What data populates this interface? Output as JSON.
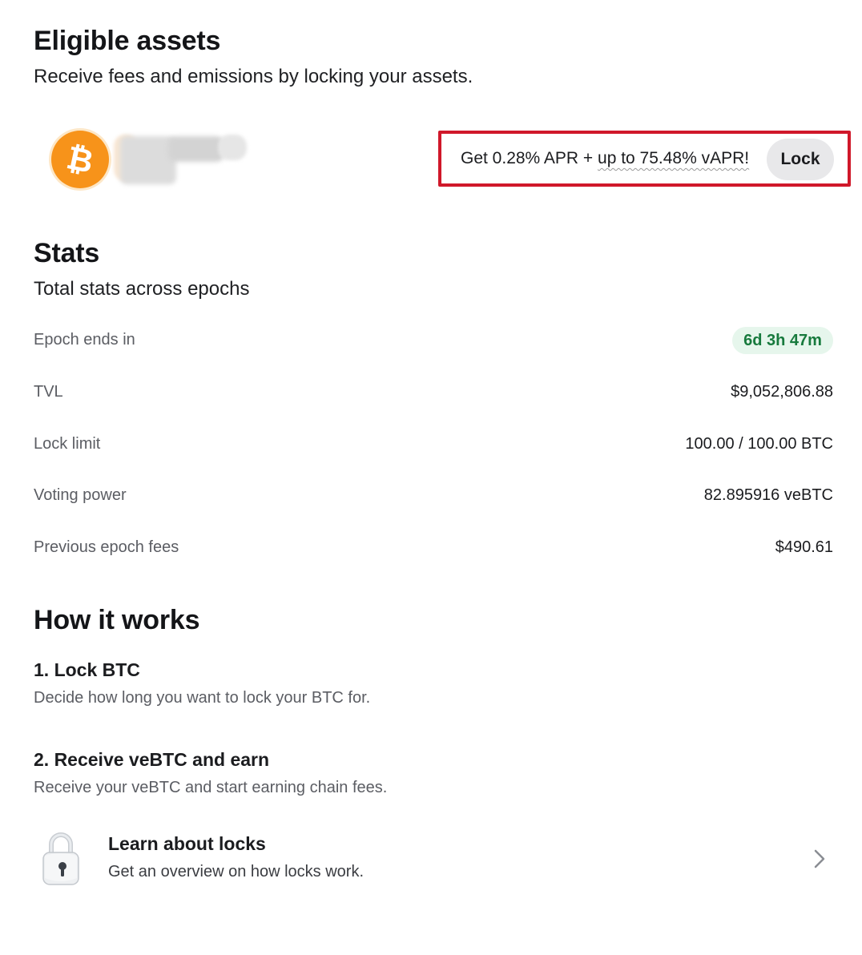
{
  "eligible": {
    "title": "Eligible assets",
    "subtitle": "Receive fees and emissions by locking your assets.",
    "asset_icon": "bitcoin-icon",
    "promo": {
      "prefix": "Get 0.28% APR + ",
      "highlight": "up to 75.48% vAPR!",
      "button_label": "Lock"
    },
    "accent_color": "#f7931a",
    "highlight_border_color": "#d0182a"
  },
  "stats": {
    "title": "Stats",
    "subtitle": "Total stats across epochs",
    "rows": [
      {
        "label": "Epoch ends in",
        "value": "6d 3h 47m"
      },
      {
        "label": "TVL",
        "value": "$9,052,806.88"
      },
      {
        "label": "Lock limit",
        "value": "100.00 / 100.00 BTC"
      },
      {
        "label": "Voting power",
        "value": "82.895916 veBTC"
      },
      {
        "label": "Previous epoch fees",
        "value": "$490.61"
      }
    ]
  },
  "how": {
    "title": "How it works",
    "steps": [
      {
        "title": "1. Lock BTC",
        "desc": "Decide how long you want to lock your BTC for."
      },
      {
        "title": "2. Receive veBTC and earn",
        "desc": "Receive your veBTC and start earning chain fees."
      }
    ],
    "learn": {
      "title": "Learn about locks",
      "desc": "Get an overview on how locks work.",
      "icon": "padlock-icon"
    }
  }
}
